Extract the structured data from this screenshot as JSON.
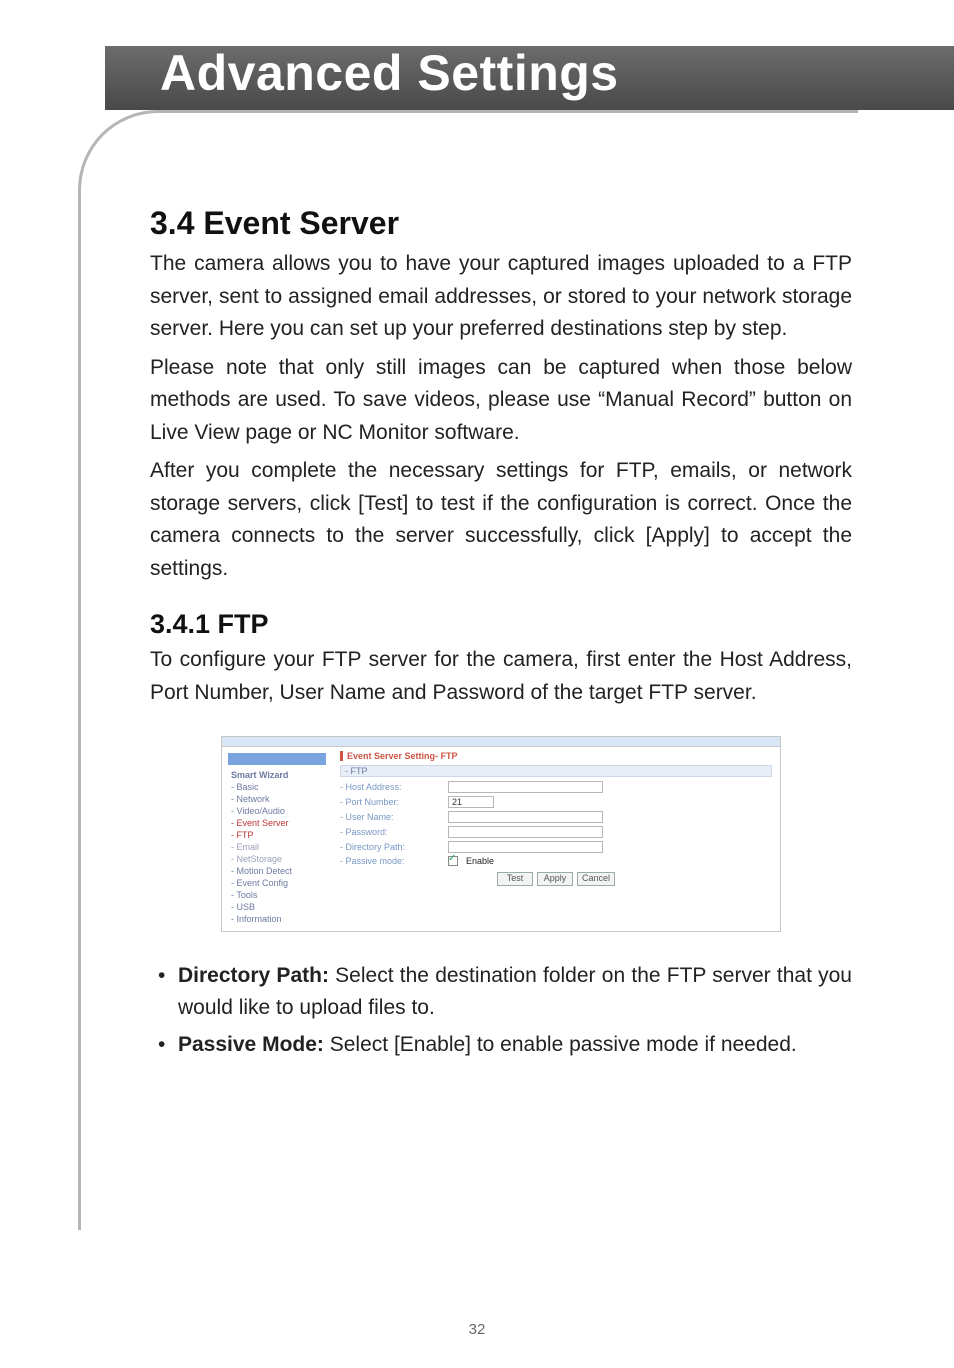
{
  "banner": {
    "title": "Advanced Settings"
  },
  "section": {
    "heading": "3.4 Event Server",
    "p1": "The camera allows you to have your captured images uploaded to a FTP server, sent to assigned email addresses, or stored to your network storage server. Here you can set up your preferred destinations step by step.",
    "p2": "Please note that only still images can be captured when those below methods are used. To save videos, please use “Manual Record” button on Live View page or NC Monitor software.",
    "p3": "After you complete the necessary settings for FTP, emails, or network storage servers, click [Test] to test if the configuration is correct. Once the camera connects to the server successfully, click [Apply] to accept the settings."
  },
  "subsection": {
    "heading": "3.4.1 FTP",
    "p1": "To configure your FTP server for the camera, first enter the Host Address, Port Number, User Name and Password of the target FTP server."
  },
  "screenshot": {
    "title": "Event Server Setting- FTP",
    "bar": "- FTP",
    "side": {
      "top_label": "Smart Wizard",
      "items": [
        "- Basic",
        "- Network",
        "- Video/Audio",
        "- Event Server",
        "- FTP",
        "- Email",
        "- NetStorage",
        "- Motion Detect",
        "- Event Config",
        "- Tools",
        "- USB",
        "- Information"
      ]
    },
    "labels": {
      "host": "- Host Address:",
      "port": "- Port Number:",
      "user": "- User Name:",
      "pass": "- Password:",
      "dir": "- Directory Path:",
      "passive": "- Passive mode:",
      "enable": "Enable"
    },
    "values": {
      "port": "21"
    },
    "buttons": {
      "test": "Test",
      "apply": "Apply",
      "cancel": "Cancel"
    }
  },
  "bullets": {
    "b1_lead": "Directory Path:",
    "b1_rest": " Select the destination folder on the FTP server that you would like to upload files to.",
    "b2_lead": "Passive Mode:",
    "b2_rest": " Select [Enable] to enable passive mode if needed."
  },
  "footer": {
    "page": "32"
  }
}
